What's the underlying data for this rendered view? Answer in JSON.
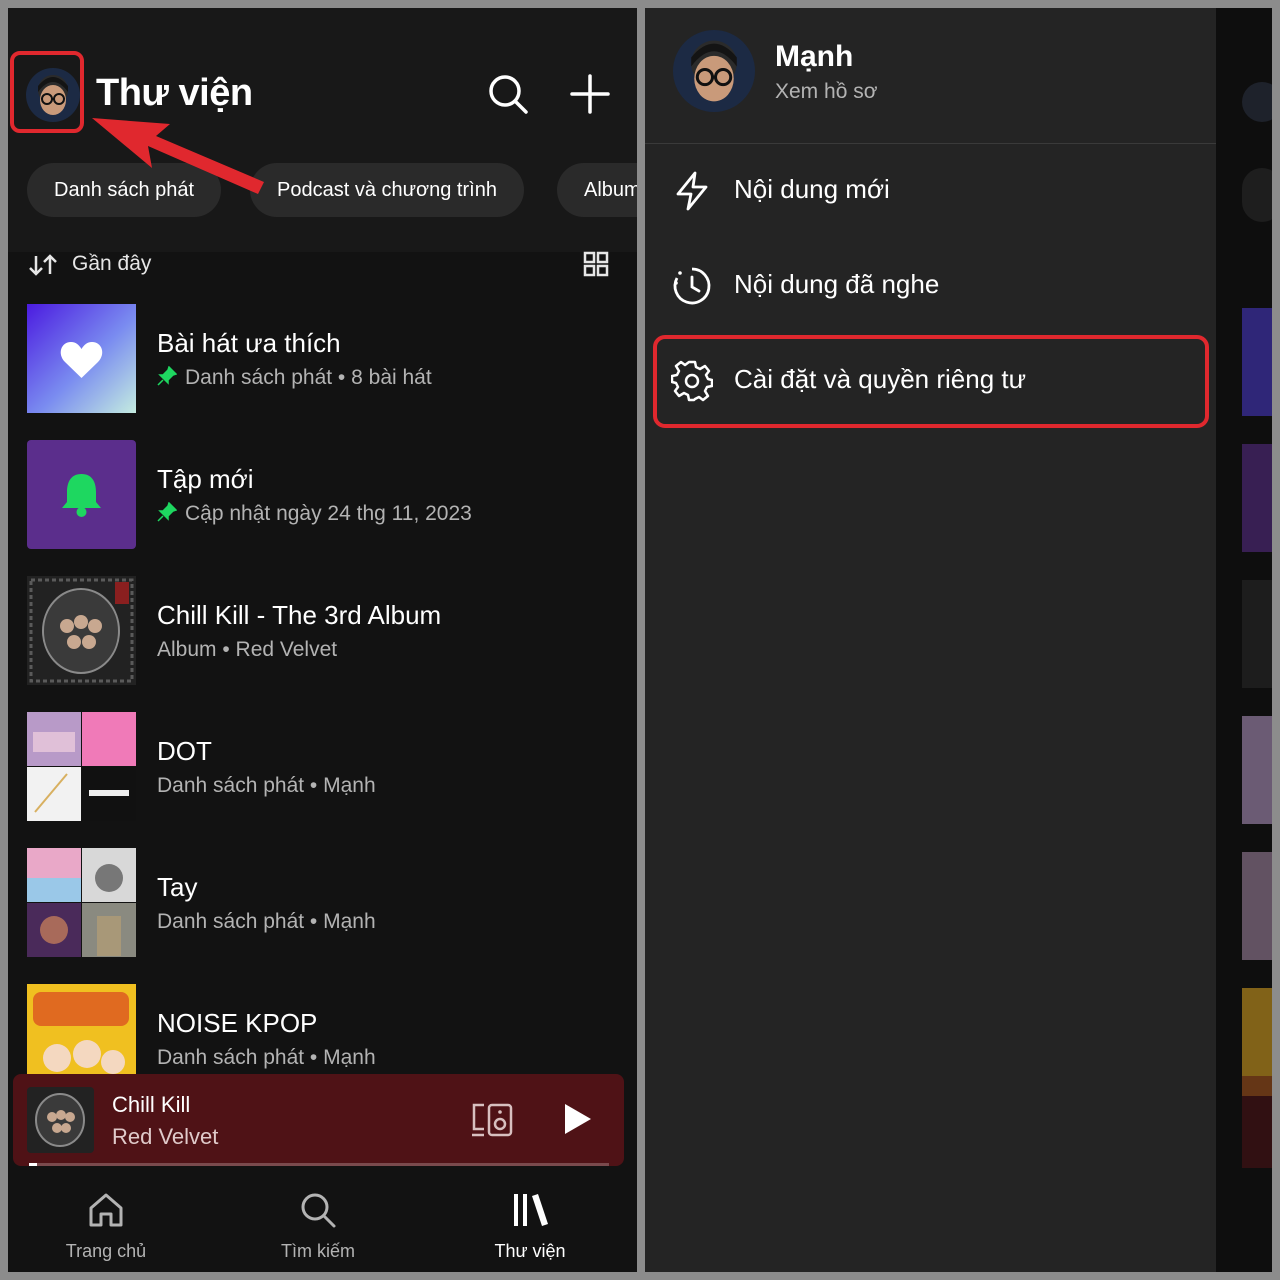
{
  "library": {
    "title": "Thư viện",
    "filters": [
      "Danh sách phát",
      "Podcast và chương trình",
      "Album"
    ],
    "sort_label": "Gần đây",
    "items": [
      {
        "title": "Bài hát ưa thích",
        "subtitle": "Danh sách phát • 8 bài hát",
        "pinned": true,
        "cover": "liked-songs"
      },
      {
        "title": "Tập mới",
        "subtitle": "Cập nhật ngày 24 thg 11, 2023",
        "pinned": true,
        "cover": "new-episodes"
      },
      {
        "title": "Chill Kill - The 3rd Album",
        "subtitle": "Album • Red Velvet",
        "pinned": false,
        "cover": "album-art"
      },
      {
        "title": "DOT",
        "subtitle": "Danh sách phát • Mạnh",
        "pinned": false,
        "cover": "playlist-mosaic"
      },
      {
        "title": "Tay",
        "subtitle": "Danh sách phát • Mạnh",
        "pinned": false,
        "cover": "playlist-mosaic"
      },
      {
        "title": "NOISE KPOP",
        "subtitle": "Danh sách phát • Mạnh",
        "pinned": false,
        "cover": "playlist-art"
      }
    ]
  },
  "now_playing": {
    "title": "Chill Kill",
    "artist": "Red Velvet",
    "progress": 0.014
  },
  "bottom_nav": [
    {
      "label": "Trang chủ",
      "icon": "home-icon",
      "active": false
    },
    {
      "label": "Tìm kiếm",
      "icon": "search-icon",
      "active": false
    },
    {
      "label": "Thư viện",
      "icon": "library-icon",
      "active": true
    }
  ],
  "drawer": {
    "profile_name": "Mạnh",
    "profile_link": "Xem hồ sơ",
    "menu": [
      {
        "label": "Nội dung mới",
        "icon": "lightning-icon"
      },
      {
        "label": "Nội dung đã nghe",
        "icon": "history-icon"
      },
      {
        "label": "Cài đặt và quyền riêng tư",
        "icon": "gear-icon"
      }
    ]
  },
  "colors": {
    "accent_green": "#1ed760",
    "highlight_red": "#e0282e",
    "player_bg": "#4f1216",
    "drawer_bg": "#242424"
  }
}
